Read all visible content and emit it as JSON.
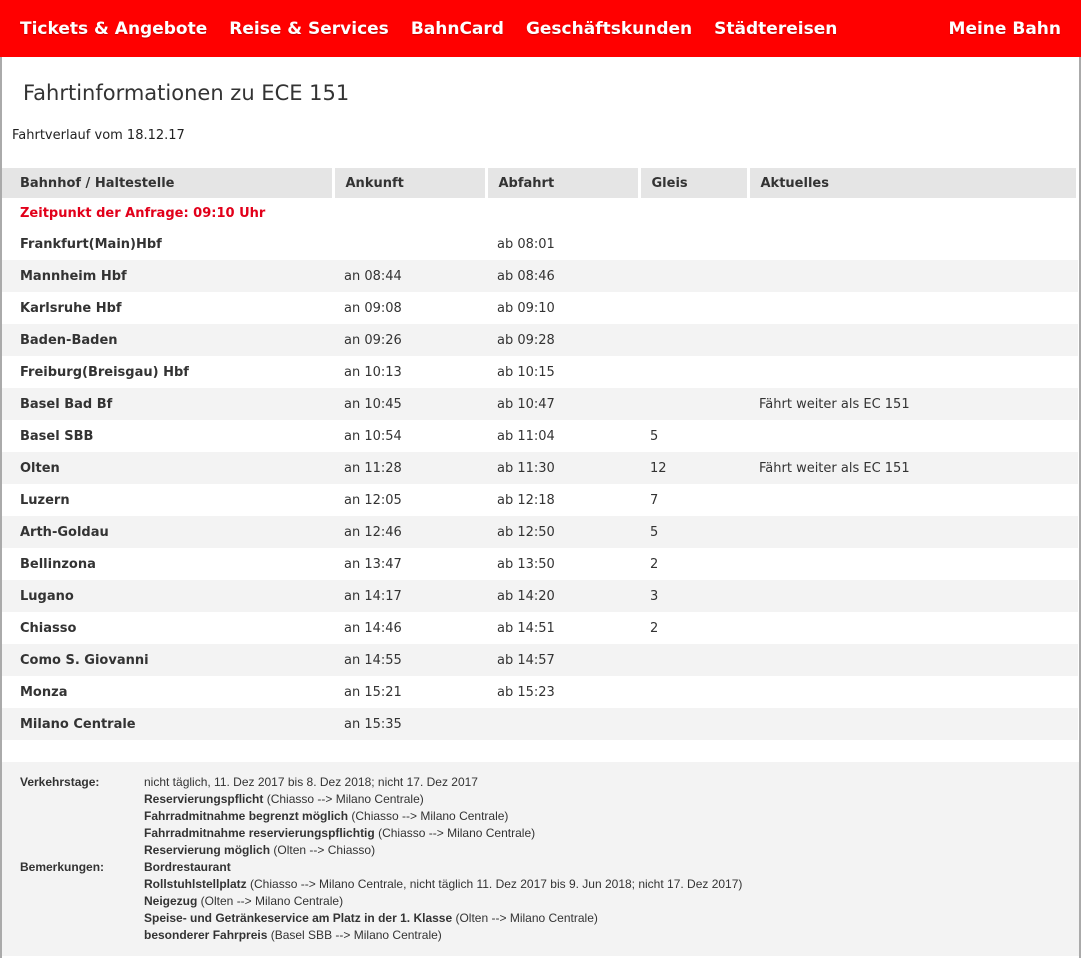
{
  "nav": {
    "items": [
      "Tickets & Angebote",
      "Reise & Services",
      "BahnCard",
      "Geschäftskunden",
      "Städtereisen"
    ],
    "right": "Meine Bahn"
  },
  "title": "Fahrtinformationen zu ECE 151",
  "subtitle": "Fahrtverlauf vom 18.12.17",
  "table": {
    "headers": [
      "Bahnhof / Haltestelle",
      "Ankunft",
      "Abfahrt",
      "Gleis",
      "Aktuelles"
    ],
    "request_time": "Zeitpunkt der Anfrage: 09:10 Uhr",
    "rows": [
      [
        "Frankfurt(Main)Hbf",
        "",
        "ab 08:01",
        "",
        ""
      ],
      [
        "Mannheim Hbf",
        "an 08:44",
        "ab 08:46",
        "",
        ""
      ],
      [
        "Karlsruhe Hbf",
        "an 09:08",
        "ab 09:10",
        "",
        ""
      ],
      [
        "Baden-Baden",
        "an 09:26",
        "ab 09:28",
        "",
        ""
      ],
      [
        "Freiburg(Breisgau) Hbf",
        "an 10:13",
        "ab 10:15",
        "",
        ""
      ],
      [
        "Basel Bad Bf",
        "an 10:45",
        "ab 10:47",
        "",
        "Fährt weiter als EC 151"
      ],
      [
        "Basel SBB",
        "an 10:54",
        "ab 11:04",
        "5",
        ""
      ],
      [
        "Olten",
        "an 11:28",
        "ab 11:30",
        "12",
        "Fährt weiter als EC 151"
      ],
      [
        "Luzern",
        "an 12:05",
        "ab 12:18",
        "7",
        ""
      ],
      [
        "Arth-Goldau",
        "an 12:46",
        "ab 12:50",
        "5",
        ""
      ],
      [
        "Bellinzona",
        "an 13:47",
        "ab 13:50",
        "2",
        ""
      ],
      [
        "Lugano",
        "an 14:17",
        "ab 14:20",
        "3",
        ""
      ],
      [
        "Chiasso",
        "an 14:46",
        "ab 14:51",
        "2",
        ""
      ],
      [
        "Como S. Giovanni",
        "an 14:55",
        "ab 14:57",
        "",
        ""
      ],
      [
        "Monza",
        "an 15:21",
        "ab 15:23",
        "",
        ""
      ],
      [
        "Milano Centrale",
        "an 15:35",
        "",
        "",
        ""
      ]
    ]
  },
  "footer": {
    "verkehrstage_label": "Verkehrstage:",
    "verkehrstage": "nicht täglich, 11. Dez 2017 bis 8. Dez 2018; nicht 17. Dez 2017",
    "bemerkungen_label": "Bemerkungen:",
    "notes_pre": [
      {
        "b": "Reservierungspflicht",
        "t": " (Chiasso --> Milano Centrale)"
      },
      {
        "b": "Fahrradmitnahme begrenzt möglich",
        "t": " (Chiasso --> Milano Centrale)"
      },
      {
        "b": "Fahrradmitnahme reservierungspflichtig",
        "t": " (Chiasso --> Milano Centrale)"
      },
      {
        "b": "Reservierung möglich",
        "t": " (Olten --> Chiasso)"
      }
    ],
    "notes": [
      {
        "b": "Bordrestaurant",
        "t": ""
      },
      {
        "b": "Rollstuhlstellplatz",
        "t": " (Chiasso --> Milano Centrale, nicht täglich 11. Dez 2017 bis 9. Jun 2018; nicht 17. Dez 2017)"
      },
      {
        "b": "Neigezug",
        "t": " (Olten --> Milano Centrale)"
      },
      {
        "b": "Speise- und Getränkeservice am Platz in der 1. Klasse",
        "t": " (Olten --> Milano Centrale)"
      },
      {
        "b": "besonderer Fahrpreis",
        "t": " (Basel SBB --> Milano Centrale)"
      }
    ]
  }
}
